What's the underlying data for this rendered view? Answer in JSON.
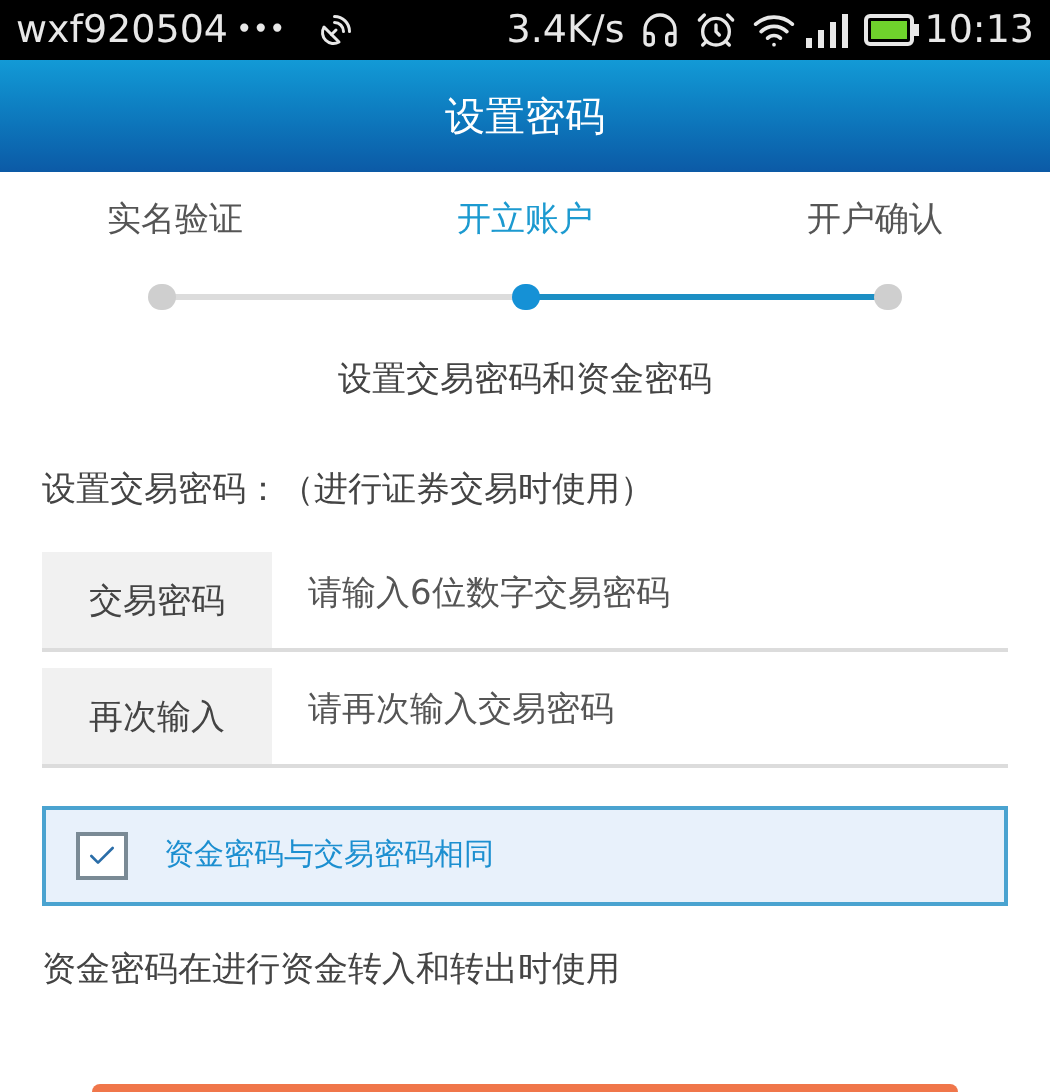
{
  "status_bar": {
    "carrier": "wxf920504",
    "dots": "•••",
    "speed": "3.4K/s",
    "time": "10:13"
  },
  "header": {
    "title": "设置密码"
  },
  "steps": [
    {
      "label": "实名验证",
      "selected": false
    },
    {
      "label": "开立账户",
      "selected": true
    },
    {
      "label": "开户确认",
      "selected": false
    }
  ],
  "subtitle": "设置交易密码和资金密码",
  "section_label": "设置交易密码：（进行证券交易时使用）",
  "fields": [
    {
      "label": "交易密码",
      "placeholder": "请输入6位数字交易密码"
    },
    {
      "label": "再次输入",
      "placeholder": "请再次输入交易密码"
    }
  ],
  "same_password": {
    "label": "资金密码与交易密码相同",
    "checked": true
  },
  "note": "资金密码在进行资金转入和转出时使用"
}
